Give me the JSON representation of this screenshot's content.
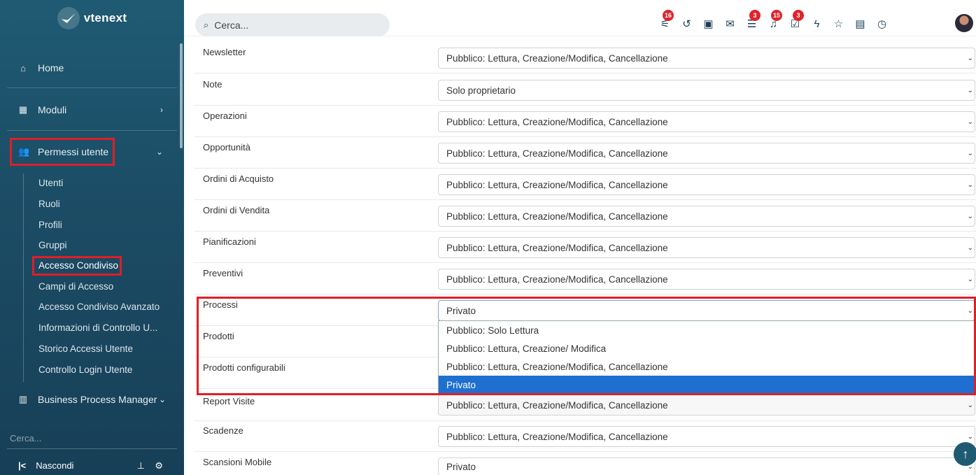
{
  "app": {
    "name": "vtenext"
  },
  "sidebar": {
    "nav": [
      {
        "icon": "home-icon",
        "label": "Home"
      },
      {
        "icon": "grid-icon",
        "label": "Moduli"
      },
      {
        "icon": "users-icon",
        "label": "Permessi utente"
      },
      {
        "icon": "building-icon",
        "label": "Business Process Manager"
      }
    ],
    "sub_items": [
      "Utenti",
      "Ruoli",
      "Profili",
      "Gruppi",
      "Accesso Condiviso",
      "Campi di Accesso",
      "Accesso Condiviso Avanzato",
      "Informazioni di Controllo U...",
      "Storico Accessi Utente",
      "Controllo Login Utente"
    ],
    "search_placeholder": "Cerca...",
    "hide_label": "Nascondi"
  },
  "header": {
    "search_placeholder": "Cerca...",
    "badges": {
      "processes": "16",
      "chat": "3",
      "notifications": "15",
      "tasks": "3"
    }
  },
  "rows": [
    {
      "label": "Newsletter",
      "value": "Pubblico: Lettura, Creazione/Modifica, Cancellazione"
    },
    {
      "label": "Note",
      "value": "Solo proprietario"
    },
    {
      "label": "Operazioni",
      "value": "Pubblico: Lettura, Creazione/Modifica, Cancellazione"
    },
    {
      "label": "Opportunità",
      "value": "Pubblico: Lettura, Creazione/Modifica, Cancellazione"
    },
    {
      "label": "Ordini di Acquisto",
      "value": "Pubblico: Lettura, Creazione/Modifica, Cancellazione"
    },
    {
      "label": "Ordini di Vendita",
      "value": "Pubblico: Lettura, Creazione/Modifica, Cancellazione"
    },
    {
      "label": "Pianificazioni",
      "value": "Pubblico: Lettura, Creazione/Modifica, Cancellazione"
    },
    {
      "label": "Preventivi",
      "value": "Pubblico: Lettura, Creazione/Modifica, Cancellazione"
    },
    {
      "label": "Processi",
      "value": "Privato"
    },
    {
      "label": "Prodotti",
      "value": ""
    },
    {
      "label": "Prodotti configurabili",
      "value": ""
    },
    {
      "label": "Report Visite",
      "value": "Pubblico: Lettura, Creazione/Modifica, Cancellazione"
    },
    {
      "label": "Scadenze",
      "value": "Pubblico: Lettura, Creazione/Modifica, Cancellazione"
    },
    {
      "label": "Scansioni Mobile",
      "value": "Privato"
    }
  ],
  "dropdown": {
    "options": [
      "Pubblico: Solo Lettura",
      "Pubblico: Lettura, Creazione/ Modifica",
      "Pubblico: Lettura, Creazione/Modifica, Cancellazione",
      "Privato"
    ],
    "selected": "Privato"
  },
  "colors": {
    "highlight": "#e01e26",
    "selected_option": "#1e6fd0",
    "sidebar": "#1c4d66"
  }
}
